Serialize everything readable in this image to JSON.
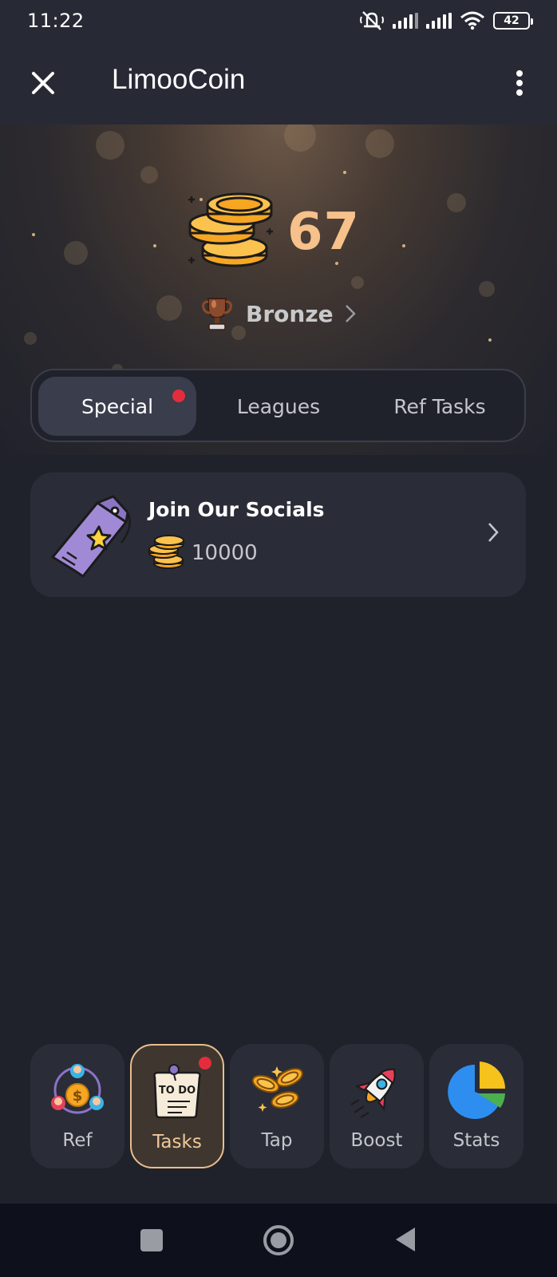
{
  "status_bar": {
    "time": "11:22",
    "battery": "42"
  },
  "app_bar": {
    "title": "LimooCoin"
  },
  "hero": {
    "balance": "67",
    "league": "Bronze"
  },
  "tabs": [
    {
      "label": "Special",
      "active": true,
      "has_badge": true
    },
    {
      "label": "Leagues",
      "active": false,
      "has_badge": false
    },
    {
      "label": "Ref Tasks",
      "active": false,
      "has_badge": false
    }
  ],
  "tasks": [
    {
      "title": "Join Our Socials",
      "reward": "10000"
    }
  ],
  "bottom_nav": [
    {
      "label": "Ref",
      "icon": "referral-icon",
      "active": false
    },
    {
      "label": "Tasks",
      "icon": "todo-icon",
      "active": true
    },
    {
      "label": "Tap",
      "icon": "coins-icon",
      "active": false
    },
    {
      "label": "Boost",
      "icon": "rocket-icon",
      "active": false
    },
    {
      "label": "Stats",
      "icon": "pie-chart-icon",
      "active": false
    }
  ],
  "colors": {
    "background": "#20222b",
    "card": "#2a2c38",
    "accent_gold": "#f6c18a",
    "badge_red": "#e32d3c"
  }
}
